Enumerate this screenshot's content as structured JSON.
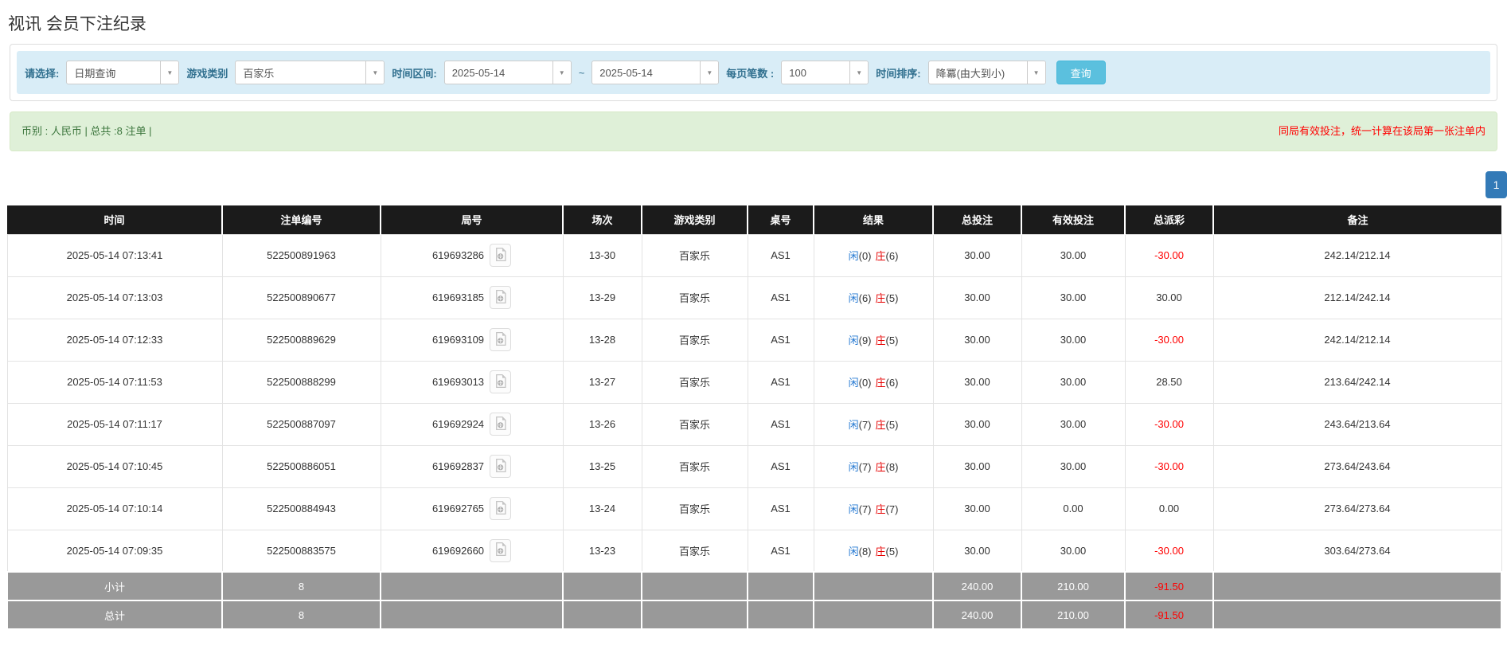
{
  "page": {
    "title": "视讯 会员下注纪录"
  },
  "filters": {
    "query_type_label": "请选择:",
    "query_type_value": "日期查询",
    "game_type_label": "游戏类别",
    "game_type_value": "百家乐",
    "time_range_label": "时间区间:",
    "date_from": "2025-05-14",
    "range_separator": "~",
    "date_to": "2025-05-14",
    "page_size_label": "每页笔数 :",
    "page_size_value": "100",
    "sort_label": "时间排序:",
    "sort_value": "降冪(由大到小)",
    "search_label": "查询",
    "dropdown_icon": "▼"
  },
  "summary": {
    "left": "币别 : 人民币 | 总共 :8 注单 |",
    "right": "同局有效投注，统一计算在该局第一张注单内"
  },
  "pagination": {
    "current": "1"
  },
  "colors": {
    "filter_bar_bg": "#d9edf7",
    "summary_bg": "#dff0d8",
    "summary_text": "#3c763d",
    "note_text": "#ff0000",
    "search_button": "#5bc0de",
    "pagination_button": "#337ab7",
    "header_bg": "#1b1b1b",
    "total_row_bg": "#999999",
    "player_blue": "#2579d2",
    "banker_red": "#e60000",
    "amount_link_blue": "#2579d2",
    "negative_red": "#ff0000"
  },
  "table": {
    "columns": [
      "时间",
      "注单编号",
      "局号",
      "场次",
      "游戏类别",
      "桌号",
      "结果",
      "总投注",
      "有效投注",
      "总派彩",
      "备注"
    ],
    "rows": [
      {
        "time": "2025-05-14 07:13:41",
        "bet_id": "522500891963",
        "round_id": "619693286",
        "session": "13-30",
        "game": "百家乐",
        "table_no": "AS1",
        "result": {
          "player_label": "闲",
          "player_score": "(0)",
          "banker_label": "庄",
          "banker_score": "(6)"
        },
        "total_bet": "30.00",
        "valid_bet": "30.00",
        "payout": "-30.00",
        "remark": "242.14/212.14"
      },
      {
        "time": "2025-05-14 07:13:03",
        "bet_id": "522500890677",
        "round_id": "619693185",
        "session": "13-29",
        "game": "百家乐",
        "table_no": "AS1",
        "result": {
          "player_label": "闲",
          "player_score": "(6)",
          "banker_label": "庄",
          "banker_score": "(5)"
        },
        "total_bet": "30.00",
        "valid_bet": "30.00",
        "payout": "30.00",
        "remark": "212.14/242.14"
      },
      {
        "time": "2025-05-14 07:12:33",
        "bet_id": "522500889629",
        "round_id": "619693109",
        "session": "13-28",
        "game": "百家乐",
        "table_no": "AS1",
        "result": {
          "player_label": "闲",
          "player_score": "(9)",
          "banker_label": "庄",
          "banker_score": "(5)"
        },
        "total_bet": "30.00",
        "valid_bet": "30.00",
        "payout": "-30.00",
        "remark": "242.14/212.14"
      },
      {
        "time": "2025-05-14 07:11:53",
        "bet_id": "522500888299",
        "round_id": "619693013",
        "session": "13-27",
        "game": "百家乐",
        "table_no": "AS1",
        "result": {
          "player_label": "闲",
          "player_score": "(0)",
          "banker_label": "庄",
          "banker_score": "(6)"
        },
        "total_bet": "30.00",
        "valid_bet": "30.00",
        "payout": "28.50",
        "remark": "213.64/242.14"
      },
      {
        "time": "2025-05-14 07:11:17",
        "bet_id": "522500887097",
        "round_id": "619692924",
        "session": "13-26",
        "game": "百家乐",
        "table_no": "AS1",
        "result": {
          "player_label": "闲",
          "player_score": "(7)",
          "banker_label": "庄",
          "banker_score": "(5)"
        },
        "total_bet": "30.00",
        "valid_bet": "30.00",
        "payout": "-30.00",
        "remark": "243.64/213.64"
      },
      {
        "time": "2025-05-14 07:10:45",
        "bet_id": "522500886051",
        "round_id": "619692837",
        "session": "13-25",
        "game": "百家乐",
        "table_no": "AS1",
        "result": {
          "player_label": "闲",
          "player_score": "(7)",
          "banker_label": "庄",
          "banker_score": "(8)"
        },
        "total_bet": "30.00",
        "valid_bet": "30.00",
        "payout": "-30.00",
        "remark": "273.64/243.64"
      },
      {
        "time": "2025-05-14 07:10:14",
        "bet_id": "522500884943",
        "round_id": "619692765",
        "session": "13-24",
        "game": "百家乐",
        "table_no": "AS1",
        "result": {
          "player_label": "闲",
          "player_score": "(7)",
          "banker_label": "庄",
          "banker_score": "(7)"
        },
        "total_bet": "30.00",
        "valid_bet": "0.00",
        "payout": "0.00",
        "remark": "273.64/273.64"
      },
      {
        "time": "2025-05-14 07:09:35",
        "bet_id": "522500883575",
        "round_id": "619692660",
        "session": "13-23",
        "game": "百家乐",
        "table_no": "AS1",
        "result": {
          "player_label": "闲",
          "player_score": "(8)",
          "banker_label": "庄",
          "banker_score": "(5)"
        },
        "total_bet": "30.00",
        "valid_bet": "30.00",
        "payout": "-30.00",
        "remark": "303.64/273.64"
      }
    ],
    "subtotal": {
      "label": "小计",
      "count": "8",
      "total_bet": "240.00",
      "valid_bet": "210.00",
      "payout": "-91.50"
    },
    "grand_total": {
      "label": "总计",
      "count": "8",
      "total_bet": "240.00",
      "valid_bet": "210.00",
      "payout": "-91.50"
    }
  }
}
